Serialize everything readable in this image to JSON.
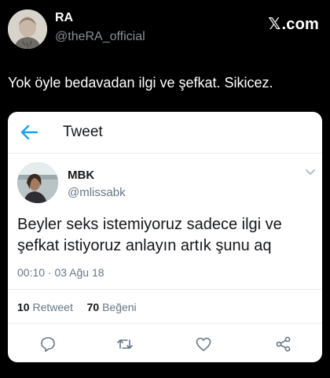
{
  "outer": {
    "name": "RA",
    "handle": "@theRA_official",
    "brand": "X.com",
    "brand_x": "𝕏",
    "brand_suffix": ".com",
    "text": "Yok öyle bedavadan ilgi ve şefkat. Sikicez."
  },
  "card": {
    "title": "Tweet",
    "author_name": "MBK",
    "author_handle": "@mlissabk",
    "text": "Beyler seks istemiyoruz sadece ilgi ve şefkat istiyoruz anlayın artık şunu aq",
    "timestamp": "00:10 · 03 Ağu 18",
    "retweet_count": "10",
    "retweet_label": "Retweet",
    "like_count": "70",
    "like_label": "Beğeni"
  },
  "icons": {
    "back": "arrow-left-icon",
    "caret": "chevron-down-icon",
    "reply": "reply-icon",
    "retweet": "retweet-icon",
    "like": "heart-icon",
    "share": "share-icon"
  },
  "colors": {
    "background": "#000000",
    "accent": "#1da1f2",
    "secondary_text": "#657786"
  }
}
